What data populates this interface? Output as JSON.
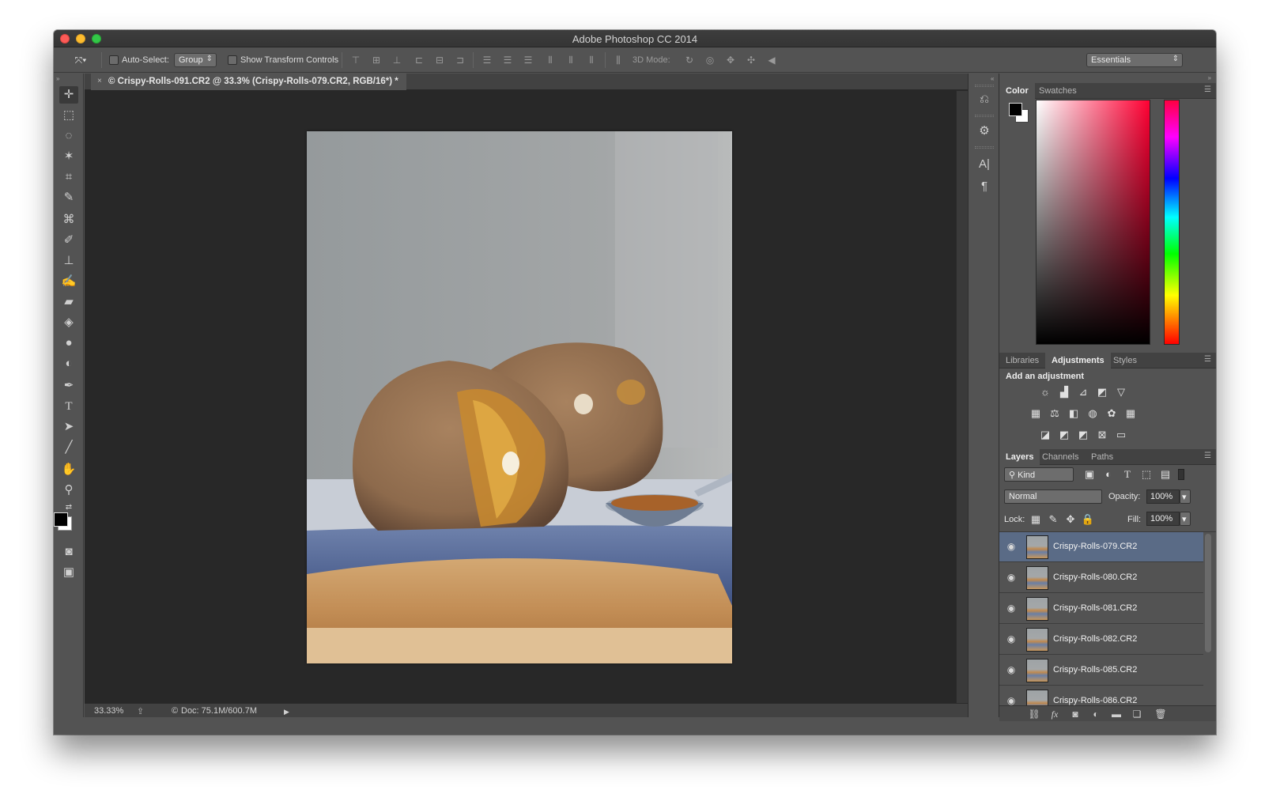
{
  "window": {
    "title": "Adobe Photoshop CC 2014"
  },
  "options_bar": {
    "auto_select_label": "Auto-Select:",
    "auto_select_value": "Group",
    "show_transform_label": "Show Transform Controls",
    "mode_3d_label": "3D Mode:",
    "workspace_value": "Essentials"
  },
  "document": {
    "tab_title": "© Crispy-Rolls-091.CR2 @ 33.3% (Crispy-Rolls-079.CR2, RGB/16*) *",
    "zoom": "33.33%",
    "doc_size": "Doc: 75.1M/600.7M"
  },
  "color_panel": {
    "tabs": [
      "Color",
      "Swatches"
    ],
    "foreground": "#000000",
    "background": "#ffffff"
  },
  "adjustments_panel": {
    "tabs": [
      "Libraries",
      "Adjustments",
      "Styles"
    ],
    "heading": "Add an adjustment"
  },
  "layers_panel": {
    "tabs": [
      "Layers",
      "Channels",
      "Paths"
    ],
    "filter_kind": "Kind",
    "blend_mode": "Normal",
    "opacity_label": "Opacity:",
    "opacity_value": "100%",
    "lock_label": "Lock:",
    "fill_label": "Fill:",
    "fill_value": "100%",
    "layers": [
      {
        "name": "Crispy-Rolls-079.CR2",
        "selected": true
      },
      {
        "name": "Crispy-Rolls-080.CR2",
        "selected": false
      },
      {
        "name": "Crispy-Rolls-081.CR2",
        "selected": false
      },
      {
        "name": "Crispy-Rolls-082.CR2",
        "selected": false
      },
      {
        "name": "Crispy-Rolls-085.CR2",
        "selected": false
      },
      {
        "name": "Crispy-Rolls-086.CR2",
        "selected": false
      }
    ]
  },
  "colors": {
    "accent_selected_layer": "#5a6b86",
    "ui_bg": "#535353",
    "canvas_bg": "#282828"
  }
}
